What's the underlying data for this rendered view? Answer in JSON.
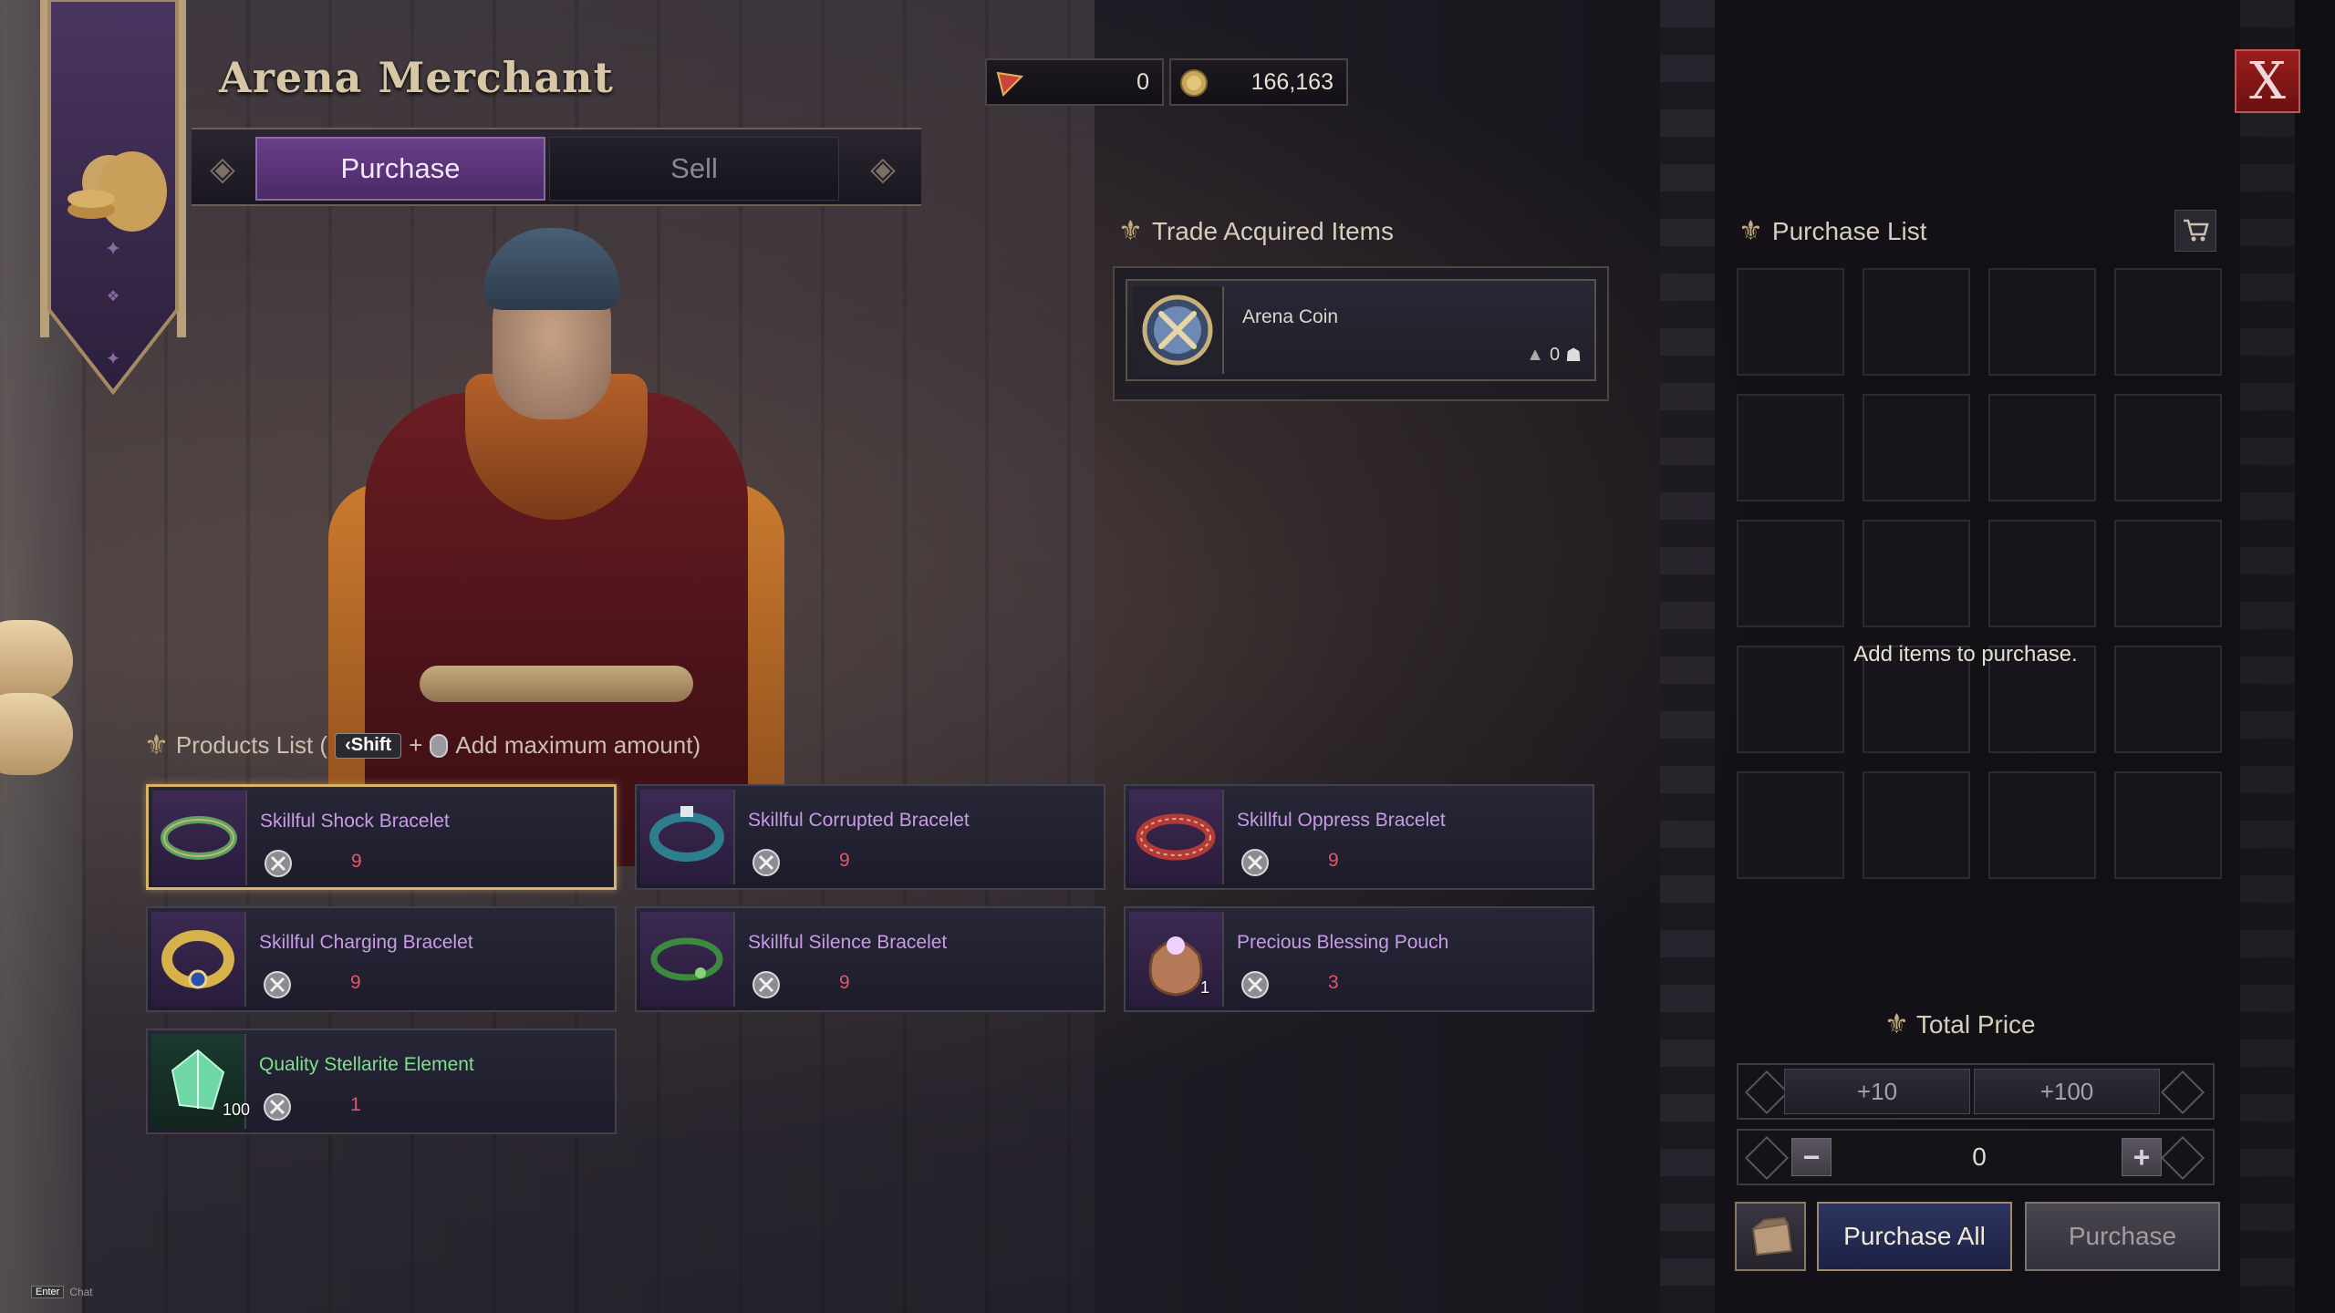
{
  "window": {
    "title": "Arena Merchant",
    "close_label": "X"
  },
  "tabs": [
    {
      "label": "Purchase",
      "active": true
    },
    {
      "label": "Sell",
      "active": false
    }
  ],
  "currency": [
    {
      "icon": "arena-pennant-icon",
      "value": "0"
    },
    {
      "icon": "silver-coin-icon",
      "value": "166,163"
    }
  ],
  "trade": {
    "header": "Trade Acquired Items",
    "item": {
      "name": "Arena Coin",
      "count": "0",
      "icon": "arena-coin-icon"
    }
  },
  "products": {
    "header_label": "Products List (",
    "shift_key": "Shift",
    "plus": "+",
    "action": "Add maximum amount)",
    "items": [
      {
        "name": "Skillful Shock Bracelet",
        "price": "9",
        "icon": "green-bracelet-icon",
        "selected": true,
        "rarity": "purple",
        "qty": ""
      },
      {
        "name": "Skillful Corrupted Bracelet",
        "price": "9",
        "icon": "teal-bracelet-icon",
        "selected": false,
        "rarity": "purple",
        "qty": ""
      },
      {
        "name": "Skillful Oppress Bracelet",
        "price": "9",
        "icon": "red-bracelet-icon",
        "selected": false,
        "rarity": "purple",
        "qty": ""
      },
      {
        "name": "Skillful Charging Bracelet",
        "price": "9",
        "icon": "gold-bracelet-icon",
        "selected": false,
        "rarity": "purple",
        "qty": ""
      },
      {
        "name": "Skillful Silence Bracelet",
        "price": "9",
        "icon": "green-ring-bracelet-icon",
        "selected": false,
        "rarity": "purple",
        "qty": ""
      },
      {
        "name": "Precious Blessing Pouch",
        "price": "3",
        "icon": "pouch-icon",
        "selected": false,
        "rarity": "purple",
        "qty": "1"
      },
      {
        "name": "Quality Stellarite Element",
        "price": "1",
        "icon": "crystal-icon",
        "selected": false,
        "rarity": "green",
        "qty": "100"
      }
    ]
  },
  "purchase_list": {
    "header": "Purchase List",
    "empty_message": "Add items to purchase."
  },
  "total": {
    "header": "Total Price",
    "plus10": "+10",
    "plus100": "+100",
    "minus": "−",
    "plus": "+",
    "quantity": "0"
  },
  "buttons": {
    "purchase_all": "Purchase All",
    "purchase": "Purchase"
  },
  "chat_hint": {
    "key": "Enter",
    "label": "Chat"
  },
  "colors": {
    "accent_purple": "#6a3e8a",
    "price_red": "#e0566b",
    "name_purple": "#c99be6",
    "name_green": "#7fe08c",
    "selected_gold": "#d8b46a",
    "close_red": "#9c1d1d"
  }
}
